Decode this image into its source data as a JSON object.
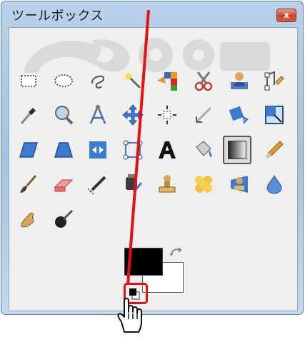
{
  "window": {
    "title": "ツールボックス",
    "close_glyph": "x"
  },
  "tools": [
    {
      "name": "rect-select-icon"
    },
    {
      "name": "ellipse-select-icon"
    },
    {
      "name": "free-select-icon"
    },
    {
      "name": "fuzzy-select-icon"
    },
    {
      "name": "select-by-color-icon"
    },
    {
      "name": "scissors-select-icon"
    },
    {
      "name": "foreground-select-icon"
    },
    {
      "name": "paths-icon"
    },
    {
      "name": "color-picker-icon"
    },
    {
      "name": "zoom-icon"
    },
    {
      "name": "measure-icon"
    },
    {
      "name": "move-icon"
    },
    {
      "name": "align-icon"
    },
    {
      "name": "crop-icon"
    },
    {
      "name": "rotate-icon"
    },
    {
      "name": "scale-icon"
    },
    {
      "name": "shear-icon"
    },
    {
      "name": "perspective-icon"
    },
    {
      "name": "flip-icon"
    },
    {
      "name": "cage-transform-icon"
    },
    {
      "name": "text-icon"
    },
    {
      "name": "bucket-fill-icon"
    },
    {
      "name": "blend-icon"
    },
    {
      "name": "pencil-icon"
    },
    {
      "name": "paintbrush-icon"
    },
    {
      "name": "eraser-icon"
    },
    {
      "name": "airbrush-icon"
    },
    {
      "name": "ink-icon"
    },
    {
      "name": "clone-icon"
    },
    {
      "name": "heal-icon"
    },
    {
      "name": "perspective-clone-icon"
    },
    {
      "name": "blur-sharpen-icon"
    },
    {
      "name": "smudge-icon"
    },
    {
      "name": "dodge-burn-icon"
    }
  ],
  "colors": {
    "foreground": "#000000",
    "background": "#ffffff",
    "highlight": "#e81010"
  }
}
